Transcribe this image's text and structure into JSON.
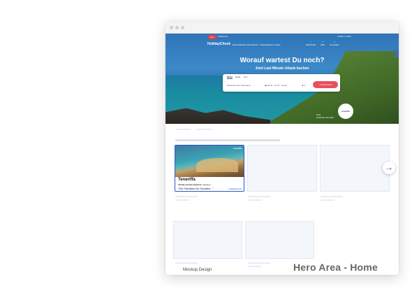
{
  "hero": {
    "badge": "Neu",
    "badge_text": "Urlaub bei",
    "logo": "HolidayCheck",
    "nav": [
      "Pauschalreisen",
      "Last Minute",
      "Hotelangebote",
      "Hotels"
    ],
    "account": "Urlaub in Sicht",
    "icons": [
      {
        "icon": "heart-icon",
        "label": "Merkzettel"
      },
      {
        "icon": "bell-icon",
        "label": "Hilfe"
      },
      {
        "icon": "user-icon",
        "label": "Anmelden"
      }
    ],
    "headline": "Worauf wartest Du noch?",
    "subheadline": "Jetzt Last Minute Urlaub buchen",
    "caption_line1": "Foto:",
    "caption_line2": "Entdecke Teneriffa",
    "partner_logo": "teneriffa"
  },
  "search": {
    "tabs": [
      "Reise",
      "Hotel"
    ],
    "tab_badge": "Neu",
    "destination_placeholder": "Reiseziel oder Hotelname",
    "dates_value": "08.03 - 22.03 · Flexib.",
    "travelers_value": "2",
    "submit_label": "Reise finden"
  },
  "card": {
    "logo": "teneriffa",
    "title": "Teneriffa",
    "subtitle_bold": "Urlaub auf den Kanaren",
    "subtitle_rest": ", Spanien",
    "quote": "\"Ein Paradies für Familien...\"",
    "brand": "HolidayCheck"
  },
  "footer": {
    "title": "Hero Area - Home",
    "subtitle": "Mockup Design"
  },
  "colors": {
    "accent": "#2b5cc4",
    "cta": "#e8505b"
  }
}
